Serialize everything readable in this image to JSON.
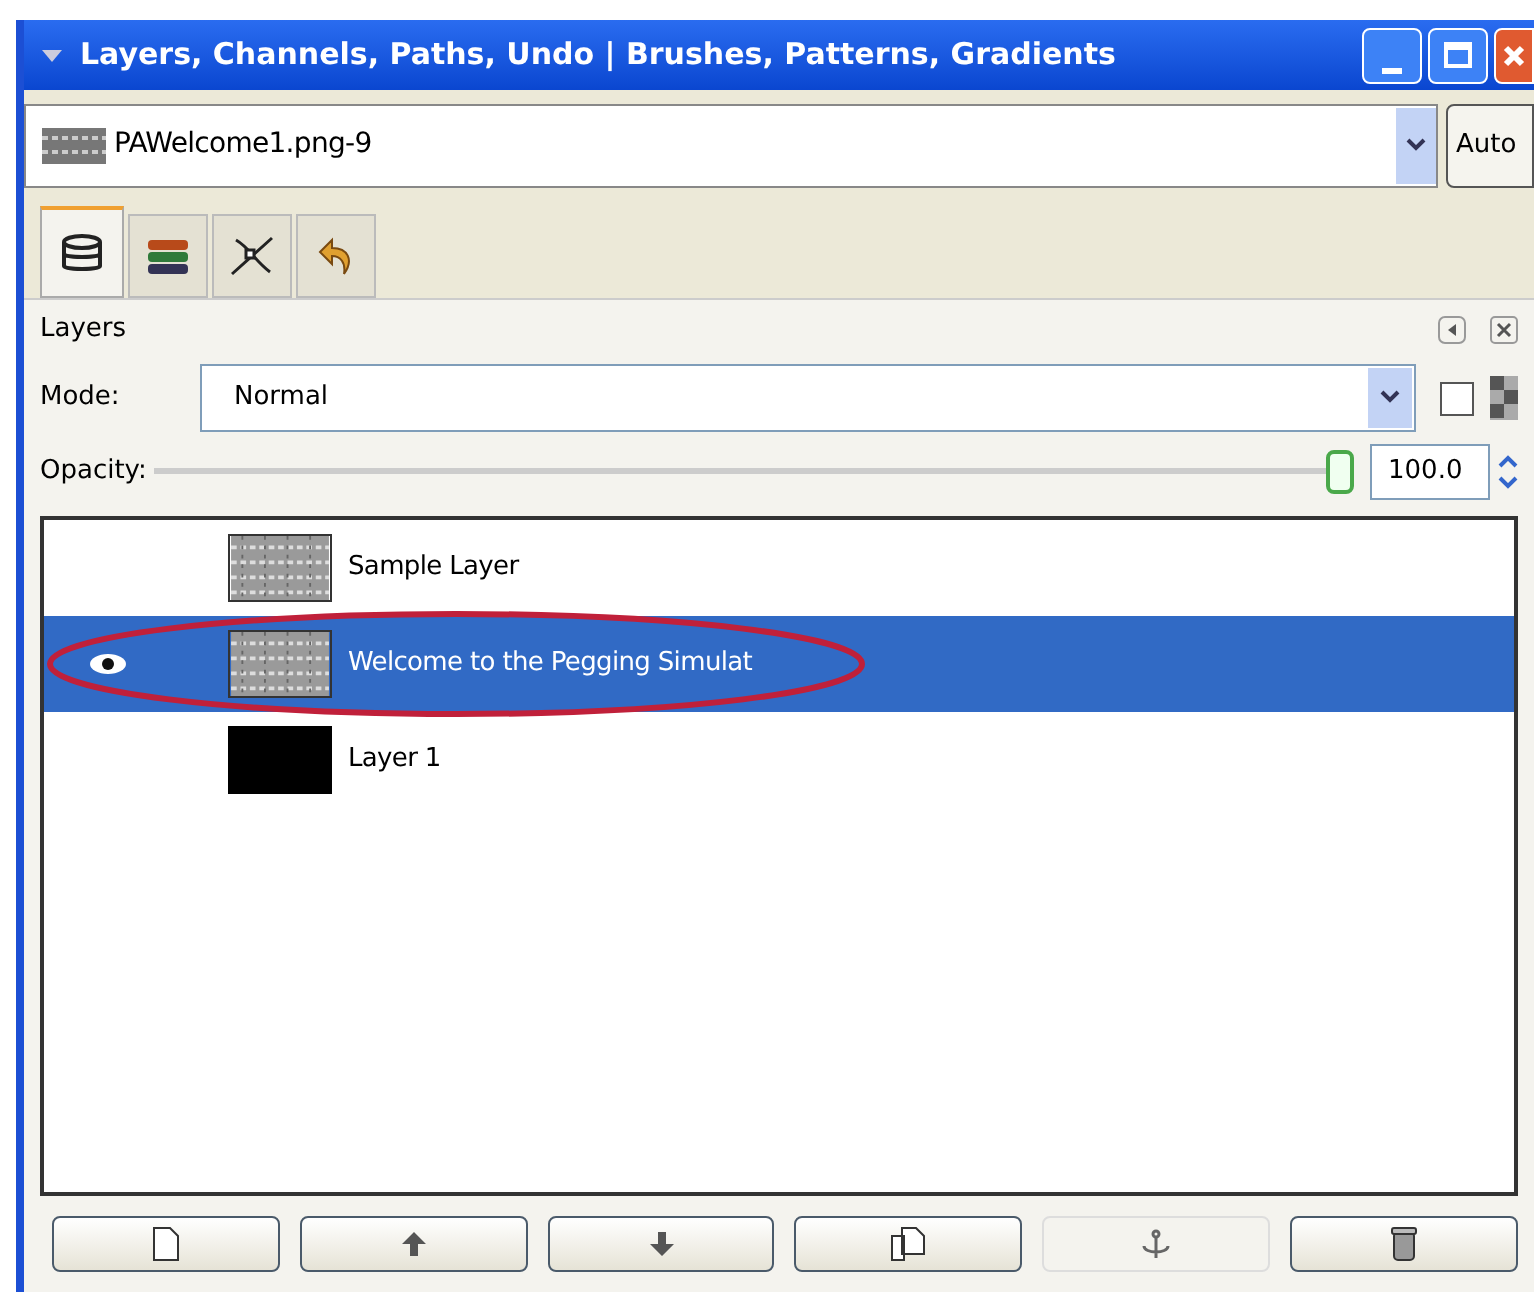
{
  "window": {
    "title": "Layers, Channels, Paths, Undo | Brushes, Patterns, Gradients"
  },
  "image_selector": {
    "value": "PAWelcome1.png-9",
    "auto_button": "Auto"
  },
  "tabs": [
    {
      "kind": "layers",
      "selected": true
    },
    {
      "kind": "channels",
      "selected": false
    },
    {
      "kind": "paths",
      "selected": false
    },
    {
      "kind": "undo",
      "selected": false
    }
  ],
  "panel": {
    "title": "Layers",
    "mode_label": "Mode:",
    "mode_value": "Normal",
    "lock_checked": false,
    "opacity_label": "Opacity:",
    "opacity": {
      "level": 1.0
    },
    "opacity_value": "100.0"
  },
  "layers": [
    {
      "name": "Sample Layer",
      "kind": "pattern",
      "visible": false,
      "selected": false
    },
    {
      "name": "Welcome to the Pegging Simulat",
      "kind": "pattern",
      "visible": true,
      "selected": true,
      "circled": true
    },
    {
      "name": "Layer 1",
      "kind": "black",
      "visible": false,
      "selected": false
    }
  ],
  "buttons": [
    {
      "kind": "new",
      "disabled": false
    },
    {
      "kind": "raise",
      "disabled": false
    },
    {
      "kind": "lower",
      "disabled": false
    },
    {
      "kind": "duplicate",
      "disabled": false
    },
    {
      "kind": "anchor",
      "disabled": true
    },
    {
      "kind": "delete",
      "disabled": false
    }
  ]
}
